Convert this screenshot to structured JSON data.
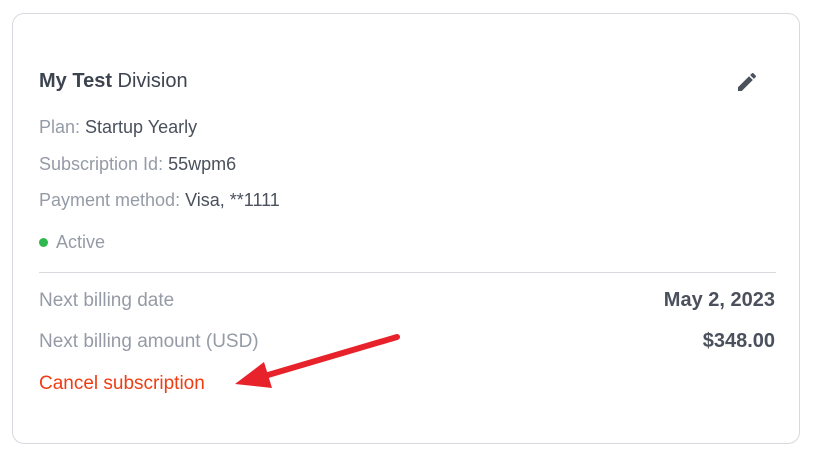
{
  "card": {
    "title_bold": "My Test",
    "title_rest": " Division",
    "edit_icon": "pencil-icon",
    "plan": {
      "label": "Plan: ",
      "value": "Startup Yearly"
    },
    "subscription_id": {
      "label": "Subscription Id: ",
      "value": "55wpm6"
    },
    "payment_method": {
      "label": "Payment method: ",
      "value": "Visa, **1111"
    },
    "status": {
      "text": "Active",
      "color": "#2fb84d"
    },
    "next_billing_date": {
      "label": "Next billing date",
      "value": "May 2, 2023"
    },
    "next_billing_amount": {
      "label": "Next billing amount (USD)",
      "value": "$348.00"
    },
    "cancel_label": "Cancel subscription"
  },
  "colors": {
    "accent_cancel": "#f03c12",
    "annotation_arrow": "#e8222a"
  }
}
